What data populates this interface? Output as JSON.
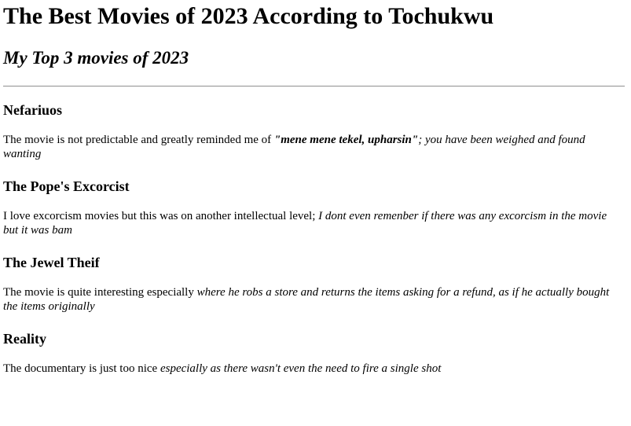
{
  "page": {
    "title": "The Best Movies of 2023 According to Tochukwu",
    "subtitle": "My Top 3 movies of 2023"
  },
  "movies": [
    {
      "title": "Nefariuos",
      "desc_plain": "The movie is not predictable and greatly reminded me of ",
      "desc_bold_italic": "\"mene mene tekel, upharsin\"",
      "desc_italic": "; you have been weighed and found wanting"
    },
    {
      "title": "The Pope's Excorcist",
      "desc_plain": "I love excorcism movies but this was on another intellectual level; ",
      "desc_italic": "I dont even remenber if there was any excorcism in the movie but it was bam"
    },
    {
      "title": "The Jewel Theif",
      "desc_plain": "The movie is quite interesting especially ",
      "desc_italic": "where he robs a store and returns the items asking for a refund, as if he actually bought the items originally"
    },
    {
      "title": "Reality",
      "desc_plain": "The documentary is just too nice ",
      "desc_italic": "especially as there wasn't even the need to fire a single shot"
    }
  ]
}
